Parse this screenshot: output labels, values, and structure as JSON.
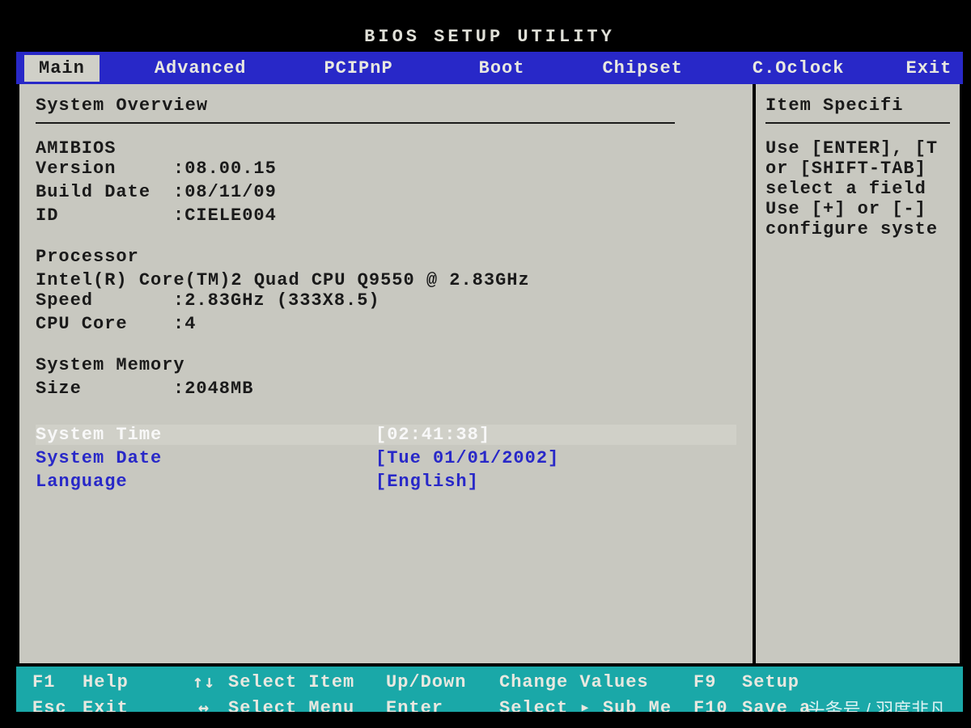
{
  "title": "BIOS SETUP UTILITY",
  "menu": {
    "items": [
      "Main",
      "Advanced",
      "PCIPnP",
      "Boot",
      "Chipset",
      "C.Oclock",
      "Exit"
    ],
    "active_index": 0
  },
  "main_panel": {
    "heading": "System Overview",
    "amibios": {
      "heading": "AMIBIOS",
      "version_label": "Version",
      "version_value": ":08.00.15",
      "build_label": "Build Date",
      "build_value": ":08/11/09",
      "id_label": "ID",
      "id_value": ":CIELE004"
    },
    "processor": {
      "heading": "Processor",
      "name": "Intel(R) Core(TM)2 Quad  CPU   Q9550  @ 2.83GHz",
      "speed_label": "Speed",
      "speed_value": ":2.83GHz (333X8.5)",
      "core_label": "CPU Core",
      "core_value": ":4"
    },
    "memory": {
      "heading": "System Memory",
      "size_label": "Size",
      "size_value": ":2048MB"
    },
    "settings": {
      "time_label": "System Time",
      "time_value": "[02:41:38]",
      "date_label": "System Date",
      "date_value": "[Tue 01/01/2002]",
      "lang_label": "Language",
      "lang_value": "[English]"
    }
  },
  "help_panel": {
    "heading": "Item Specifi",
    "line1": "Use [ENTER], [T",
    "line2": "or [SHIFT-TAB] ",
    "line3": "select a field",
    "line4": "",
    "line5": "Use [+] or [-] ",
    "line6": "configure syste"
  },
  "footer": {
    "row1": {
      "k1": "F1",
      "a1": "Help",
      "k2": "↑↓",
      "a2": "Select Item",
      "k3": "Up/Down",
      "a3": "Change Values",
      "k4": "F9",
      "a4": "Setup"
    },
    "row2": {
      "k1": "Esc",
      "a1": "Exit",
      "k2": "↔",
      "a2": "Select Menu",
      "k3": "Enter",
      "a3": "Select ▸ Sub Me",
      "k4": "F10",
      "a4": "Save a"
    }
  },
  "watermark": "头条号 / 羽度非凡"
}
